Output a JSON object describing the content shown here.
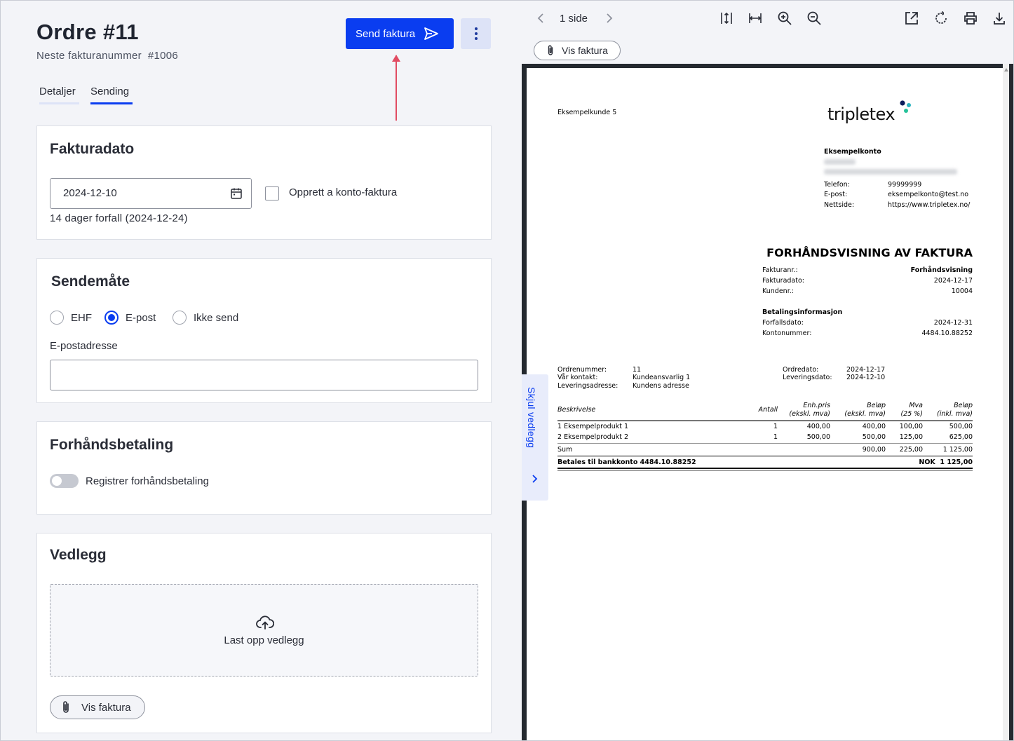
{
  "order": {
    "title": "Ordre #11",
    "next_invoice_label": "Neste fakturanummer",
    "next_invoice_number": "#1006",
    "send_button": "Send faktura"
  },
  "tabs": [
    {
      "label": "Detaljer",
      "active": false
    },
    {
      "label": "Sending",
      "active": true
    }
  ],
  "invoice_date_card": {
    "heading": "Fakturadato",
    "date_value": "2024-12-10",
    "on_account_label": "Opprett a konto-faktura",
    "on_account_checked": false,
    "due_text": "14 dager forfall (2024-12-24)"
  },
  "send_method_card": {
    "heading": "Sendemåte",
    "options": [
      {
        "label": "EHF",
        "selected": false
      },
      {
        "label": "E-post",
        "selected": true
      },
      {
        "label": "Ikke send",
        "selected": false
      }
    ],
    "email_label": "E-postadresse",
    "email_value": ""
  },
  "prepayment_card": {
    "heading": "Forhåndsbetaling",
    "toggle_label": "Registrer forhåndsbetaling",
    "toggle_on": false
  },
  "attachments_card": {
    "heading": "Vedlegg",
    "upload_label": "Last opp vedlegg",
    "view_invoice_button": "Vis faktura"
  },
  "viewer": {
    "page_count": "1 side",
    "view_invoice_pill": "Vis faktura",
    "hide_attachments_tab": "Skjul vedlegg"
  },
  "invoice_preview": {
    "customer": "Eksempelkunde 5",
    "logo": "tripletex",
    "company_name": "Eksempelkonto",
    "contact": [
      {
        "label": "Telefon:",
        "value": "99999999"
      },
      {
        "label": "E-post:",
        "value": "eksempelkonto@test.no"
      },
      {
        "label": "Nettside:",
        "value": "https://www.tripletex.no/"
      }
    ],
    "doc_title": "FORHÅNDSVISNING AV FAKTURA",
    "meta": [
      {
        "label": "Fakturanr.:",
        "value": "Forhåndsvisning",
        "bold": true
      },
      {
        "label": "Fakturadato:",
        "value": "2024-12-17"
      },
      {
        "label": "Kundenr.:",
        "value": "10004"
      }
    ],
    "payment_heading": "Betalingsinformasjon",
    "payment": [
      {
        "label": "Forfallsdato:",
        "value": "2024-12-31"
      },
      {
        "label": "Kontonummer:",
        "value": "4484.10.88252"
      }
    ],
    "order_info_left": [
      {
        "label": "Ordrenummer:",
        "value": "11"
      },
      {
        "label": "Vår kontakt:",
        "value": "Kundeansvarlig 1"
      },
      {
        "label": "Leveringsadresse:",
        "value": "Kundens adresse"
      }
    ],
    "order_info_right": [
      {
        "label": "Ordredato:",
        "value": "2024-12-17"
      },
      {
        "label": "Leveringsdato:",
        "value": "2024-12-10"
      }
    ],
    "table_headers": {
      "desc": "Beskrivelse",
      "qty": "Antall",
      "unit_1": "Enh.pris",
      "unit_2": "(ekskl. mva)",
      "amount_1": "Beløp",
      "amount_2": "(ekskl. mva)",
      "vat_1": "Mva",
      "vat_2": "(25 %)",
      "total_1": "Beløp",
      "total_2": "(inkl. mva)"
    },
    "rows": [
      {
        "desc": "1 Eksempelprodukt 1",
        "qty": "1",
        "unit": "400,00",
        "amount": "400,00",
        "vat": "100,00",
        "total": "500,00"
      },
      {
        "desc": "2 Eksempelprodukt 2",
        "qty": "1",
        "unit": "500,00",
        "amount": "500,00",
        "vat": "125,00",
        "total": "625,00"
      }
    ],
    "sum": {
      "label": "Sum",
      "amount": "900,00",
      "vat": "225,00",
      "total": "1 125,00"
    },
    "pay_line": {
      "label": "Betales til bankkonto 4484.10.88252",
      "currency_total": "NOK  1 125,00"
    }
  }
}
